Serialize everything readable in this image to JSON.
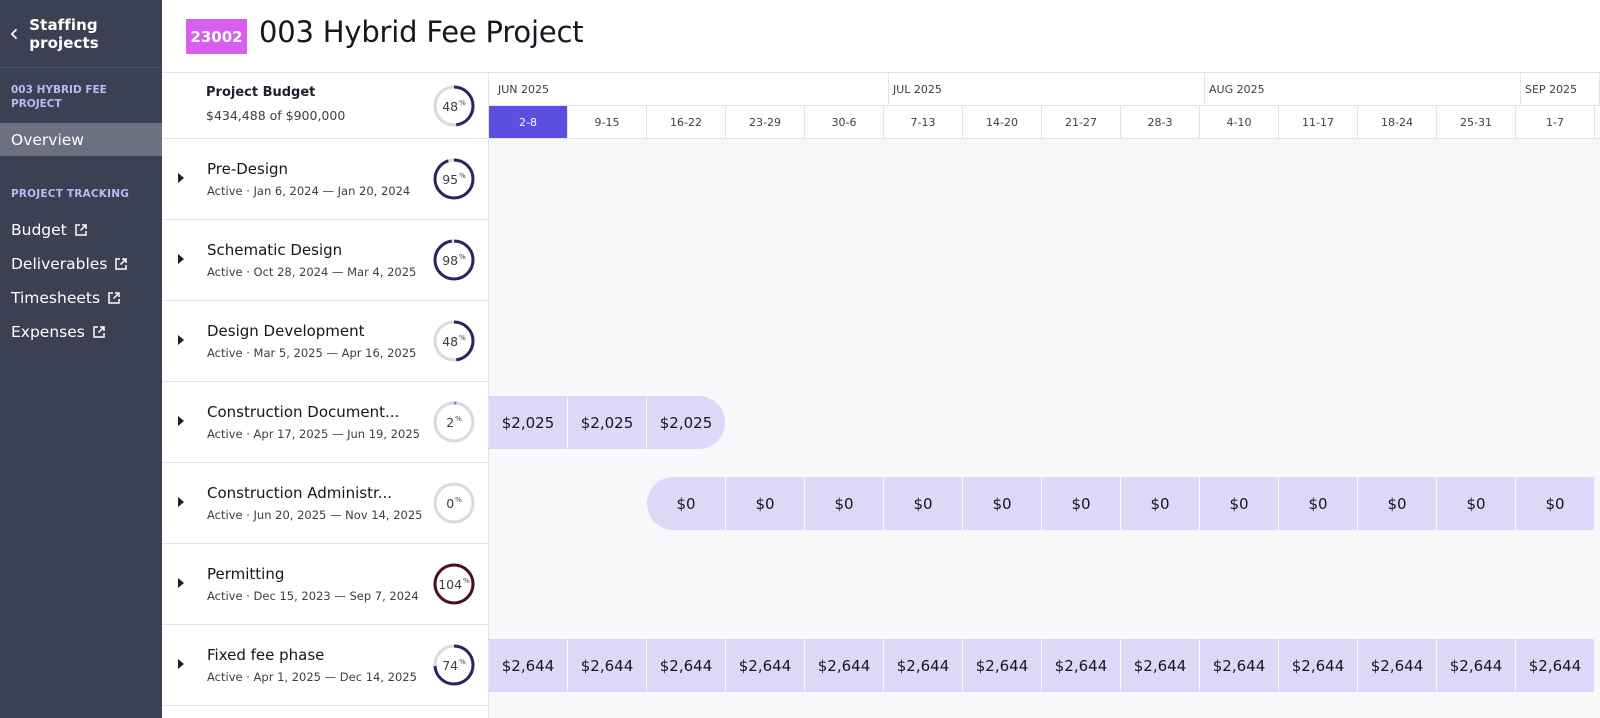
{
  "sidebar": {
    "back_label": "Staffing projects",
    "project_name": "003 HYBRID FEE PROJECT",
    "overview_label": "Overview",
    "section_title": "PROJECT TRACKING",
    "links": [
      {
        "label": "Budget"
      },
      {
        "label": "Deliverables"
      },
      {
        "label": "Timesheets"
      },
      {
        "label": "Expenses"
      }
    ]
  },
  "header": {
    "badge": "23002",
    "title": "003 Hybrid Fee Project",
    "badge_color": "#d85ef0"
  },
  "budget": {
    "title": "Project Budget",
    "summary": "$434,488 of $900,000",
    "percent": 48
  },
  "phases": [
    {
      "name": "Pre-Design",
      "meta": "Active · Jan 6, 2024 — Jan 20, 2024",
      "percent": 95
    },
    {
      "name": "Schematic Design",
      "meta": "Active · Oct 28, 2024 — Mar 4, 2025",
      "percent": 98
    },
    {
      "name": "Design Development",
      "meta": "Active · Mar 5, 2025 — Apr 16, 2025",
      "percent": 48
    },
    {
      "name": "Construction Document...",
      "meta": "Active · Apr 17, 2025 — Jun 19, 2025",
      "percent": 2
    },
    {
      "name": "Construction Administr...",
      "meta": "Active · Jun 20, 2025 — Nov 14, 2025",
      "percent": 0
    },
    {
      "name": "Permitting",
      "meta": "Active · Dec 15, 2023 — Sep 7, 2024",
      "percent": 104
    },
    {
      "name": "Fixed fee phase",
      "meta": "Active · Apr 1, 2025 — Dec 14, 2025",
      "percent": 74
    }
  ],
  "timeline": {
    "months": [
      "JUN 2025",
      "JUL 2025",
      "AUG 2025",
      "SEP 2025"
    ],
    "month_week_counts": [
      5,
      4,
      4,
      1
    ],
    "weeks": [
      "2-8",
      "9-15",
      "16-22",
      "23-29",
      "30-6",
      "7-13",
      "14-20",
      "21-27",
      "28-3",
      "4-10",
      "11-17",
      "18-24",
      "25-31",
      "1-7"
    ],
    "current_week_index": 0,
    "rows": [
      {
        "phase_index": 3,
        "start": 0,
        "values": [
          "$2,025",
          "$2,025",
          "$2,025"
        ],
        "ends_in_view": true,
        "starts_in_view": false
      },
      {
        "phase_index": 4,
        "start": 2,
        "values": [
          "$0",
          "$0",
          "$0",
          "$0",
          "$0",
          "$0",
          "$0",
          "$0",
          "$0",
          "$0",
          "$0",
          "$0"
        ],
        "ends_in_view": false,
        "starts_in_view": true
      },
      {
        "phase_index": 6,
        "start": 0,
        "values": [
          "$2,644",
          "$2,644",
          "$2,644",
          "$2,644",
          "$2,644",
          "$2,644",
          "$2,644",
          "$2,644",
          "$2,644",
          "$2,644",
          "$2,644",
          "$2,644",
          "$2,644",
          "$2,644"
        ],
        "ends_in_view": false,
        "starts_in_view": false
      }
    ]
  },
  "colors": {
    "sidebar_bg": "#3b4052",
    "accent": "#5b4fe0",
    "bar_fill": "#ddd8f8",
    "gauge_normal": "#27275e",
    "gauge_over": "#4a1020",
    "gauge_partial": "#8a82e0",
    "gauge_track": "#d9dae0"
  }
}
